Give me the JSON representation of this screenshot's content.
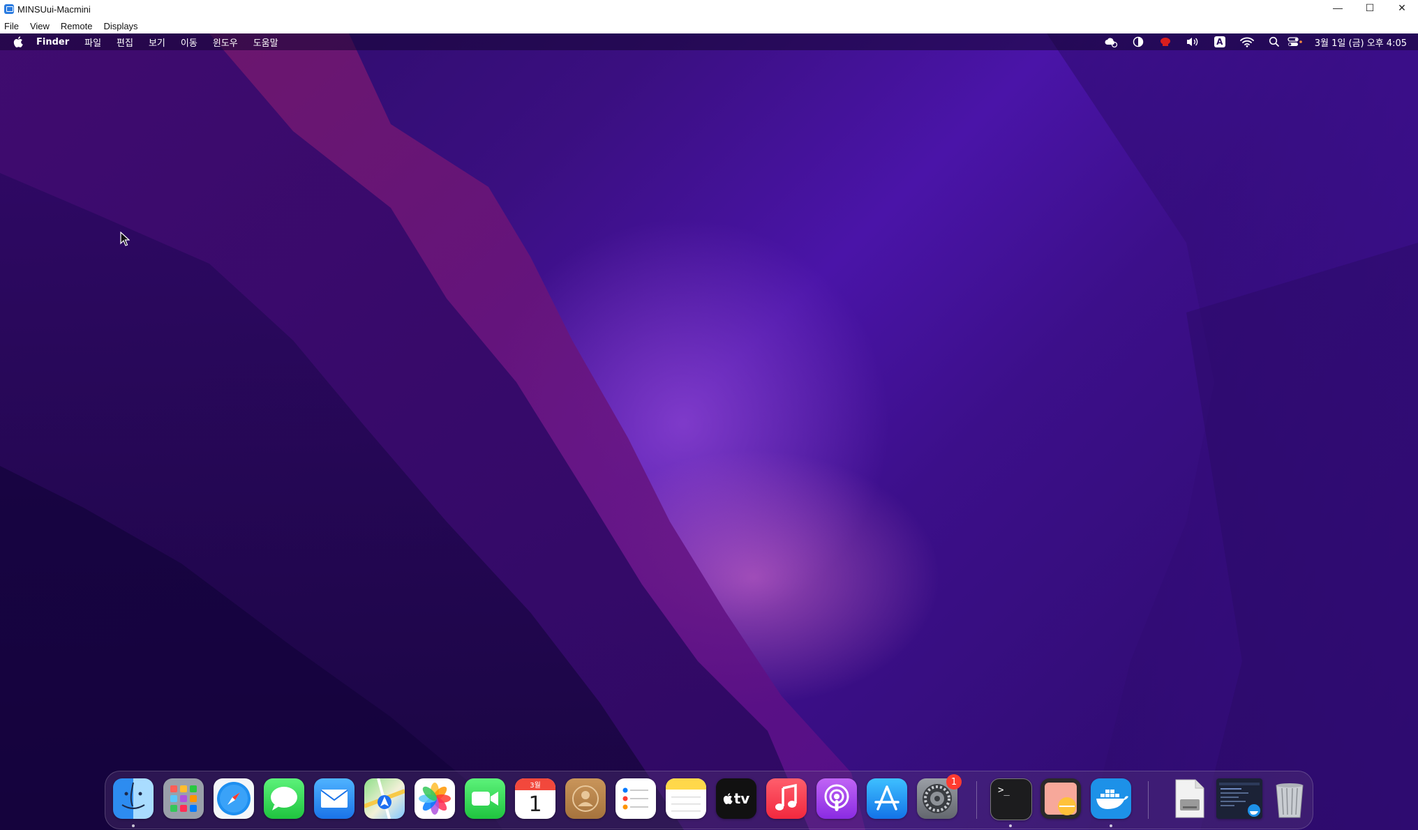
{
  "window": {
    "title": "MINSUui-Macmini",
    "controls": {
      "minimize": "—",
      "maximize": "☐",
      "close": "✕"
    }
  },
  "client_menu": [
    "File",
    "View",
    "Remote",
    "Displays"
  ],
  "mac_menubar": {
    "app_name": "Finder",
    "menus": [
      "파일",
      "편집",
      "보기",
      "이동",
      "윈도우",
      "도움말"
    ],
    "clock": "3월 1일 (금) 오후 4:05",
    "keyboard_input": "A"
  },
  "dock": {
    "apps": [
      {
        "name": "Finder",
        "icon": "finder-icon"
      },
      {
        "name": "Launchpad",
        "icon": "launchpad-icon"
      },
      {
        "name": "Safari",
        "icon": "safari-icon"
      },
      {
        "name": "Messages",
        "icon": "messages-icon"
      },
      {
        "name": "Mail",
        "icon": "mail-icon"
      },
      {
        "name": "Maps",
        "icon": "maps-icon"
      },
      {
        "name": "Photos",
        "icon": "photos-icon"
      },
      {
        "name": "FaceTime",
        "icon": "facetime-icon"
      },
      {
        "name": "Calendar",
        "icon": "calendar-icon",
        "month": "3월",
        "day": "1"
      },
      {
        "name": "Contacts",
        "icon": "contacts-icon"
      },
      {
        "name": "Reminders",
        "icon": "reminders-icon"
      },
      {
        "name": "Notes",
        "icon": "notes-icon"
      },
      {
        "name": "TV",
        "icon": "tv-icon",
        "label": "tv"
      },
      {
        "name": "Music",
        "icon": "music-icon"
      },
      {
        "name": "Podcasts",
        "icon": "podcasts-icon"
      },
      {
        "name": "App Store",
        "icon": "appstore-icon"
      },
      {
        "name": "System Settings",
        "icon": "settings-icon",
        "badge": "1"
      },
      {
        "name": "Terminal",
        "icon": "terminal-icon",
        "prompt": ">_"
      },
      {
        "name": "Preview",
        "icon": "preview-icon"
      },
      {
        "name": "Docker",
        "icon": "docker-icon"
      },
      {
        "name": "Disk Image",
        "icon": "disk-image-icon"
      },
      {
        "name": "Docker Desktop Window",
        "icon": "window-thumbnail-icon"
      },
      {
        "name": "Trash",
        "icon": "trash-icon"
      }
    ]
  }
}
